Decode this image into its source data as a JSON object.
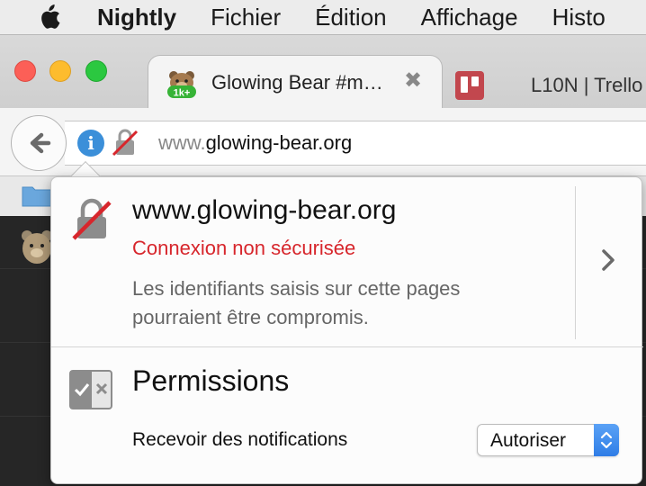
{
  "menubar": {
    "app_name": "Nightly",
    "items": [
      "Fichier",
      "Édition",
      "Affichage",
      "Histo"
    ]
  },
  "tabs": {
    "active": {
      "title": "Glowing Bear #m…",
      "favicon_badge": "1k+",
      "close": "✖"
    },
    "inactive": {
      "title": "L10N | Trello"
    }
  },
  "navbar": {
    "url_prefix": "www.",
    "url_host": "glowing-bear.org"
  },
  "popup": {
    "host": "www.glowing-bear.org",
    "status": "Connexion non sécurisée",
    "description": "Les identifiants saisis sur cette pages pourraient être compromis.",
    "permissions_title": "Permissions",
    "permission_label": "Recevoir des notifications",
    "permission_value": "Autoriser"
  },
  "colors": {
    "insecure_red": "#d7262c",
    "info_blue": "#3b8fd9",
    "select_blue": "#2f7de6"
  }
}
